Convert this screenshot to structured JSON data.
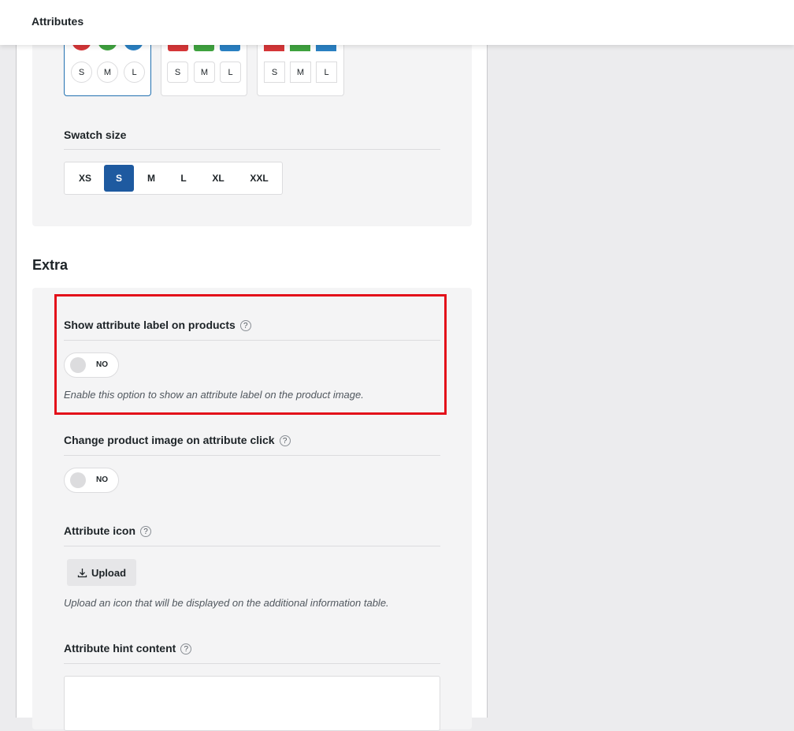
{
  "header": {
    "title": "Attributes"
  },
  "layout_previews": [
    {
      "style": "round",
      "sizes": [
        "S",
        "M",
        "L"
      ],
      "colors": [
        "#d63638",
        "#3fa33f",
        "#2a80c3"
      ],
      "selected": true
    },
    {
      "style": "rounded",
      "sizes": [
        "S",
        "M",
        "L"
      ],
      "colors": [
        "#d63638",
        "#3fa33f",
        "#2a80c3"
      ],
      "selected": false
    },
    {
      "style": "square",
      "sizes": [
        "S",
        "M",
        "L"
      ],
      "colors": [
        "#d63638",
        "#3fa33f",
        "#2a80c3"
      ],
      "selected": false
    }
  ],
  "swatch_size": {
    "label": "Swatch size",
    "options": [
      "XS",
      "S",
      "M",
      "L",
      "XL",
      "XXL"
    ],
    "selected": "S"
  },
  "extra": {
    "heading": "Extra",
    "show_label": {
      "label": "Show attribute label on products",
      "help": "?",
      "toggle_state": "NO",
      "description": "Enable this option to show an attribute label on the product image."
    },
    "change_image": {
      "label": "Change product image on attribute click",
      "help": "?",
      "toggle_state": "NO"
    },
    "attribute_icon": {
      "label": "Attribute icon",
      "help": "?",
      "upload_label": "Upload",
      "description": "Upload an icon that will be displayed on the additional information table."
    },
    "hint_content": {
      "label": "Attribute hint content",
      "help": "?",
      "value": ""
    }
  },
  "colors": {
    "accent": "#1e5aa0",
    "highlight": "#e3101a",
    "selected_border": "#2271b1"
  }
}
